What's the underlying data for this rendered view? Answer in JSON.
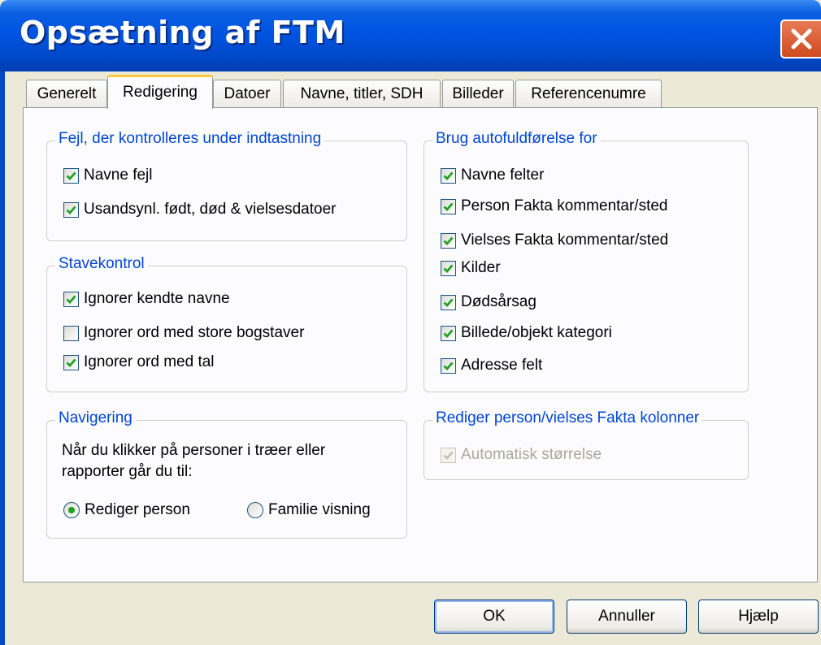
{
  "window": {
    "title": "Opsætning af FTM"
  },
  "tabs": [
    {
      "label": "Generelt",
      "active": false
    },
    {
      "label": "Redigering",
      "active": true
    },
    {
      "label": "Datoer",
      "active": false
    },
    {
      "label": "Navne, titler, SDH",
      "active": false
    },
    {
      "label": "Billeder",
      "active": false
    },
    {
      "label": "Referencenumre",
      "active": false
    }
  ],
  "errors_group": {
    "title": "Fejl, der kontrolleres under indtastning",
    "items": [
      {
        "label": "Navne fejl",
        "checked": true
      },
      {
        "label": "Usandsynl. født, død & vielsesdatoer",
        "checked": true
      }
    ]
  },
  "spell_group": {
    "title": "Stavekontrol",
    "items": [
      {
        "label": "Ignorer kendte navne",
        "checked": true
      },
      {
        "label": "Ignorer ord med store bogstaver",
        "checked": false
      },
      {
        "label": "Ignorer ord med tal",
        "checked": true
      }
    ]
  },
  "nav_group": {
    "title": "Navigering",
    "description_line1": "Når du klikker på personer i træer eller",
    "description_line2": "rapporter går du til:",
    "options": [
      {
        "label": "Rediger person",
        "selected": true
      },
      {
        "label": "Familie visning",
        "selected": false
      }
    ]
  },
  "autocomplete_group": {
    "title": "Brug autofuldførelse for",
    "items": [
      {
        "label": "Navne felter",
        "checked": true
      },
      {
        "label": "Person Fakta kommentar/sted",
        "checked": true
      },
      {
        "label": "Vielses Fakta kommentar/sted",
        "checked": true
      },
      {
        "label": "Kilder",
        "checked": true
      },
      {
        "label": "Dødsårsag",
        "checked": true
      },
      {
        "label": "Billede/objekt kategori",
        "checked": true
      },
      {
        "label": "Adresse felt",
        "checked": true
      }
    ]
  },
  "columns_group": {
    "title": "Rediger person/vielses Fakta kolonner",
    "items": [
      {
        "label": "Automatisk størrelse",
        "checked": true,
        "disabled": true
      }
    ]
  },
  "buttons": {
    "ok": "OK",
    "cancel": "Annuller",
    "help": "Hjælp"
  },
  "colors": {
    "title_bar": "#0054e3",
    "group_title": "#0046d5",
    "check": "#21a121",
    "active_tab_highlight": "#ffc83c"
  }
}
